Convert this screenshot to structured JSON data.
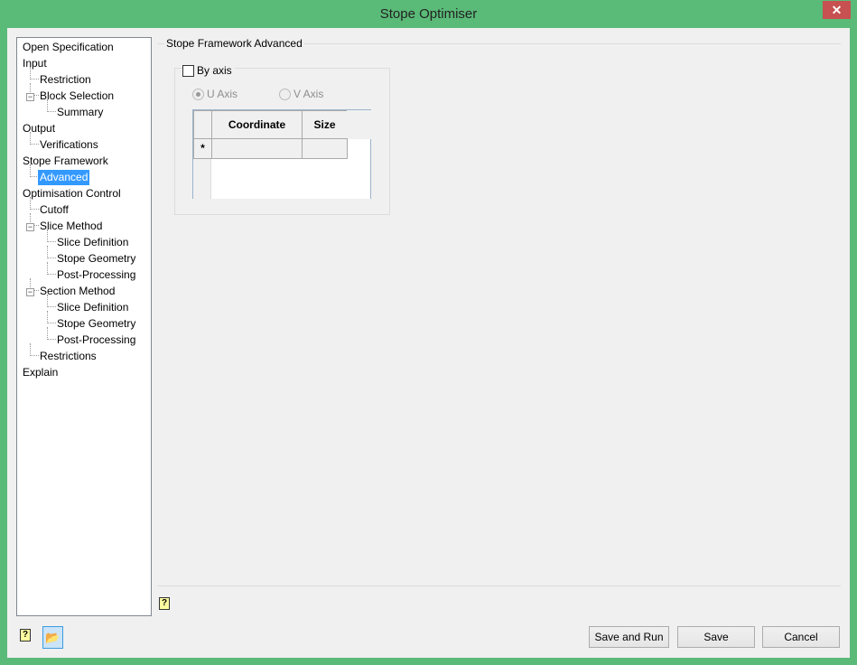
{
  "window": {
    "title": "Stope Optimiser",
    "close_icon": "close-icon"
  },
  "tree": [
    {
      "label": "Open Specification",
      "level": 0
    },
    {
      "label": "Input",
      "level": 0
    },
    {
      "label": "Restriction",
      "level": 1
    },
    {
      "label": "Block Selection",
      "level": 1,
      "expanded": true
    },
    {
      "label": "Summary",
      "level": 2
    },
    {
      "label": "Output",
      "level": 0
    },
    {
      "label": "Verifications",
      "level": 1
    },
    {
      "label": "Stope Framework",
      "level": 0
    },
    {
      "label": "Advanced",
      "level": 1,
      "selected": true
    },
    {
      "label": "Optimisation Control",
      "level": 0
    },
    {
      "label": "Cutoff",
      "level": 1
    },
    {
      "label": "Slice Method",
      "level": 1,
      "expanded": true
    },
    {
      "label": "Slice Definition",
      "level": 2
    },
    {
      "label": "Stope Geometry",
      "level": 2
    },
    {
      "label": "Post-Processing",
      "level": 2
    },
    {
      "label": "Section Method",
      "level": 1,
      "expanded": true
    },
    {
      "label": "Slice Definition",
      "level": 2
    },
    {
      "label": "Stope Geometry",
      "level": 2
    },
    {
      "label": "Post-Processing",
      "level": 2
    },
    {
      "label": "Restrictions",
      "level": 1
    },
    {
      "label": "Explain",
      "level": 0
    }
  ],
  "panel": {
    "title": "Stope Framework Advanced",
    "by_axis_label": "By axis",
    "by_axis_checked": false,
    "u_axis_label": "U Axis",
    "v_axis_label": "V Axis",
    "selected_axis": "U Axis",
    "grid": {
      "columns": [
        "Coordinate",
        "Size"
      ],
      "new_row_marker": "*"
    }
  },
  "buttons": {
    "save_and_run": "Save and Run",
    "save": "Save",
    "cancel": "Cancel"
  },
  "help_icon_text": "?"
}
